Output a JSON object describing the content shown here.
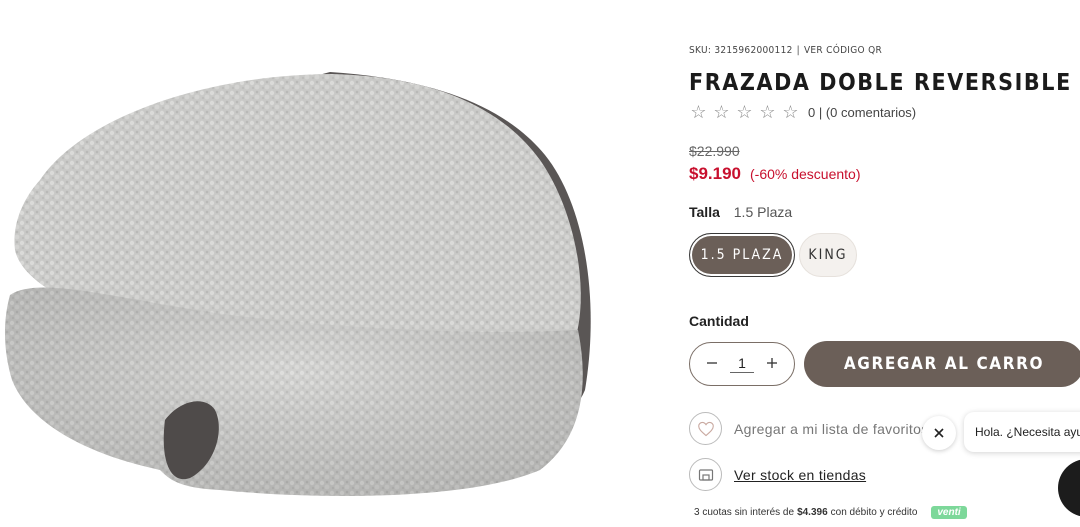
{
  "product": {
    "sku_label": "SKU: 3215962000112",
    "sku_separator": "|",
    "qr_link": "VER CÓDIGO QR",
    "title": "FRAZADA DOBLE REVERSIBLE",
    "stars_total": 5,
    "rating_value": 0,
    "reviews_text": "0 | (0 comentarios)",
    "old_price": "$22.990",
    "price": "$9.190",
    "discount": "(-60% descuento)",
    "size_label": "Talla",
    "size_selected": "1.5 Plaza",
    "sizes": [
      {
        "label": "1.5 PLAZA",
        "selected": true
      },
      {
        "label": "KING",
        "selected": false
      }
    ],
    "quantity_label": "Cantidad",
    "quantity_value": "1",
    "add_to_cart": "AGREGAR AL CARRO",
    "wishlist_text": "Agregar a mi lista de favoritos",
    "stock_text": "Ver stock en tiendas",
    "installments": {
      "prefix": "3 cuotas sin interés de",
      "amount": "$4.396",
      "suffix": "con débito y crédito",
      "badge": "venti"
    }
  },
  "chat": {
    "bubble_text": "Hola. ¿Necesita ayuda?"
  },
  "colors": {
    "accent": "#6b5f58",
    "sale": "#c8102e",
    "badge": "#7dd89a"
  },
  "icons": {
    "quantity_minus": "minus-icon",
    "quantity_plus": "plus-icon",
    "wishlist": "heart-icon",
    "stock": "store-icon",
    "close": "close-icon"
  }
}
